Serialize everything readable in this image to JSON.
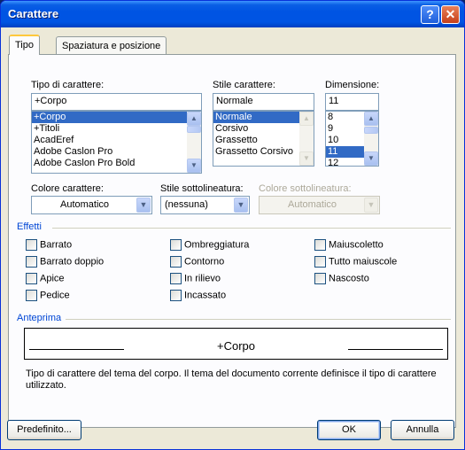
{
  "window": {
    "title": "Carattere"
  },
  "tabs": [
    {
      "label": "Tipo"
    },
    {
      "label": "Spaziatura e posizione"
    }
  ],
  "font": {
    "label": "Tipo di carattere:",
    "value": "+Corpo",
    "items": [
      "+Corpo",
      "+Titoli",
      "AcadEref",
      "Adobe Caslon Pro",
      "Adobe Caslon Pro Bold"
    ],
    "selected_index": 0
  },
  "style": {
    "label": "Stile carattere:",
    "value": "Normale",
    "items": [
      "Normale",
      "Corsivo",
      "Grassetto",
      "Grassetto Corsivo"
    ],
    "selected_index": 0
  },
  "size": {
    "label": "Dimensione:",
    "value": "11",
    "items": [
      "8",
      "9",
      "10",
      "11",
      "12"
    ],
    "selected_index": 3
  },
  "font_color": {
    "label": "Colore carattere:",
    "value": "Automatico"
  },
  "underline_style": {
    "label": "Stile sottolineatura:",
    "value": "(nessuna)"
  },
  "underline_color": {
    "label": "Colore sottolineatura:",
    "value": "Automatico",
    "disabled": true
  },
  "effects": {
    "title": "Effetti",
    "items": [
      {
        "label": "Barrato",
        "checked": false
      },
      {
        "label": "Barrato doppio",
        "checked": false
      },
      {
        "label": "Apice",
        "checked": false
      },
      {
        "label": "Pedice",
        "checked": false
      },
      {
        "label": "Ombreggiatura",
        "checked": false
      },
      {
        "label": "Contorno",
        "checked": false
      },
      {
        "label": "In rilievo",
        "checked": false
      },
      {
        "label": "Incassato",
        "checked": false
      },
      {
        "label": "Maiuscoletto",
        "checked": false
      },
      {
        "label": "Tutto maiuscole",
        "checked": false
      },
      {
        "label": "Nascosto",
        "checked": false
      }
    ]
  },
  "preview": {
    "title": "Anteprima",
    "text": "+Corpo",
    "description": "Tipo di carattere del tema del corpo. Il tema del documento corrente definisce il tipo di carattere utilizzato."
  },
  "buttons": {
    "default_label": "Predefinito...",
    "ok_label": "OK",
    "cancel_label": "Annulla"
  },
  "colors": {
    "accent": "#0046d5",
    "selection": "#316ac5",
    "titlebar": "#0054e3"
  }
}
